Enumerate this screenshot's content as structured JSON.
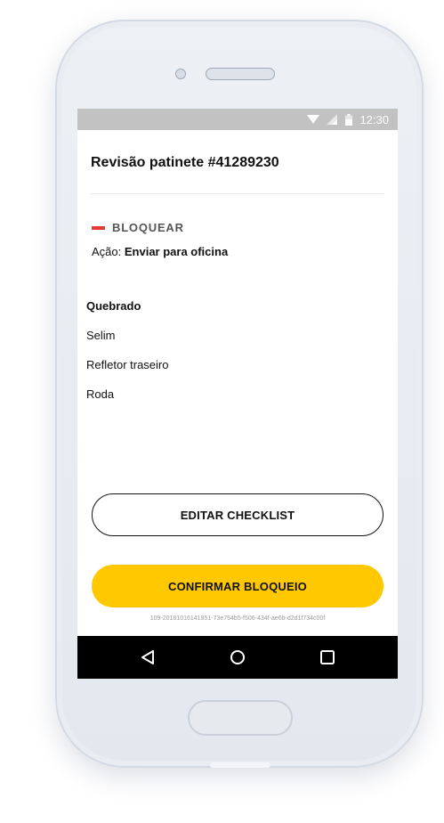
{
  "status_bar": {
    "time": "12:30",
    "icons": [
      "wifi-icon",
      "signal-icon",
      "battery-icon"
    ]
  },
  "header": {
    "title": "Revisão patinete #41289230"
  },
  "block": {
    "label": "BLOQUEAR",
    "color": "#e53935",
    "action_prefix": "Ação: ",
    "action_value": "Enviar para oficina"
  },
  "broken": {
    "title": "Quebrado",
    "items": [
      "Selim",
      "Refletor traseiro",
      "Roda"
    ]
  },
  "buttons": {
    "edit_checklist": "EDITAR CHECKLIST",
    "confirm_block": "CONFIRMAR BLOQUEIO",
    "confirm_color": "#ffc800"
  },
  "footer": {
    "id": "109-20181016141851-73e754b5-f506-434f-ae6b-d2d1f734c00f"
  },
  "nav_bar": {
    "icons": [
      "back-icon",
      "home-icon",
      "recents-icon"
    ]
  }
}
